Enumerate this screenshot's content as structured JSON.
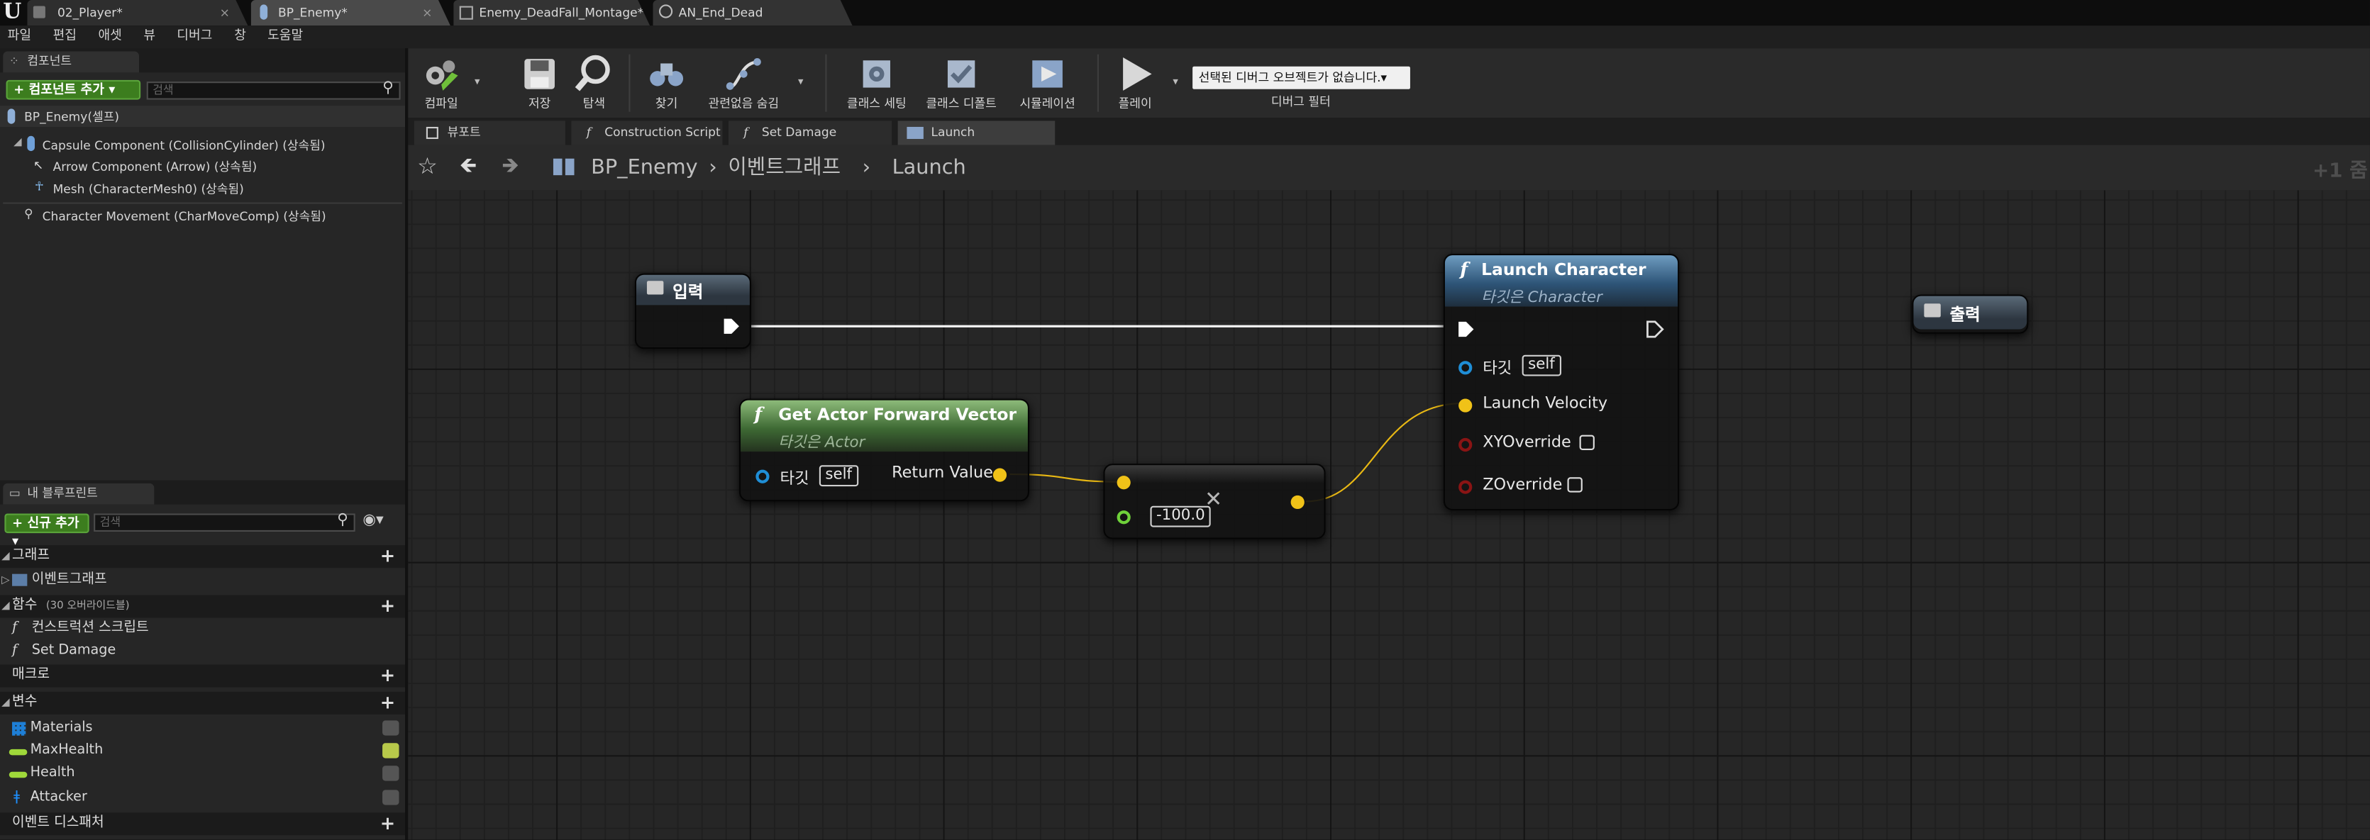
{
  "tabs": [
    {
      "label": "02_Player*"
    },
    {
      "label": "BP_Enemy*"
    },
    {
      "label": "Enemy_DeadFall_Montage*"
    },
    {
      "label": "AN_End_Dead"
    }
  ],
  "menu": [
    "파일",
    "편집",
    "애셋",
    "뷰",
    "디버그",
    "창",
    "도움말"
  ],
  "components_panel": {
    "tab_label": "컴포넌트",
    "add_button": "+ 컴포넌트 추가 ▾",
    "search_placeholder": "검색",
    "root": "BP_Enemy(셀프)",
    "items": [
      "Capsule Component (CollisionCylinder) (상속됨)",
      "Arrow Component (Arrow) (상속됨)",
      "Mesh (CharacterMesh0) (상속됨)",
      "Character Movement (CharMoveComp) (상속됨)"
    ]
  },
  "my_blueprint": {
    "tab_label": "내 블루프린트",
    "add_button": "+ 신규 추가 ▾",
    "search_placeholder": "검색",
    "sections": {
      "graphs": "그래프",
      "event_graph": "이벤트그래프",
      "functions": "함수",
      "functions_note": "(30 오버라이드블)",
      "construction": "컨스트럭션 스크립트",
      "set_damage": "Set Damage",
      "macros": "매크로",
      "variables": "변수",
      "dispatchers": "이벤트 디스패처"
    },
    "variables": [
      {
        "name": "Materials",
        "icon": "grid-icon",
        "color": "#1e7fd6"
      },
      {
        "name": "MaxHealth",
        "icon": "pill-icon",
        "color": "#9fd83a"
      },
      {
        "name": "Health",
        "icon": "pill-icon",
        "color": "#9fd83a"
      },
      {
        "name": "Attacker",
        "icon": "person-icon",
        "color": "#1e90ff"
      }
    ]
  },
  "toolbar": {
    "compile": "컴파일",
    "save": "저장",
    "browse": "탐색",
    "find": "찾기",
    "hide_unrelated": "관련없음 숨김",
    "class_settings": "클래스 세팅",
    "class_defaults": "클래스 디폴트",
    "simulation": "시뮬레이션",
    "play": "플레이",
    "debug_select": "선택된 디버그 오브젝트가 없습니다.▾",
    "debug_filter": "디버그 필터"
  },
  "graph_tabs": [
    {
      "label": "뷰포트",
      "icon": "viewport-icon"
    },
    {
      "label": "Construction Script",
      "icon": "function-icon"
    },
    {
      "label": "Set Damage",
      "icon": "function-icon"
    },
    {
      "label": "Launch",
      "icon": "graph-icon"
    }
  ],
  "breadcrumb": {
    "blueprint": "BP_Enemy",
    "graph": "이벤트그래프",
    "current": "Launch",
    "zoom": "+1 줌"
  },
  "nodes": {
    "input": {
      "title": "입력"
    },
    "output": {
      "title": "출력"
    },
    "forward": {
      "title": "Get Actor Forward Vector",
      "subtitle": "타깃은 Actor",
      "target_label": "타깃",
      "target_value": "self",
      "return_label": "Return Value"
    },
    "multiply": {
      "value": "-100.0"
    },
    "launch": {
      "title": "Launch Character",
      "subtitle": "타깃은 Character",
      "target_label": "타깃",
      "target_value": "self",
      "velocity_label": "Launch Velocity",
      "xy_label": "XYOverride",
      "z_label": "ZOverride"
    }
  }
}
